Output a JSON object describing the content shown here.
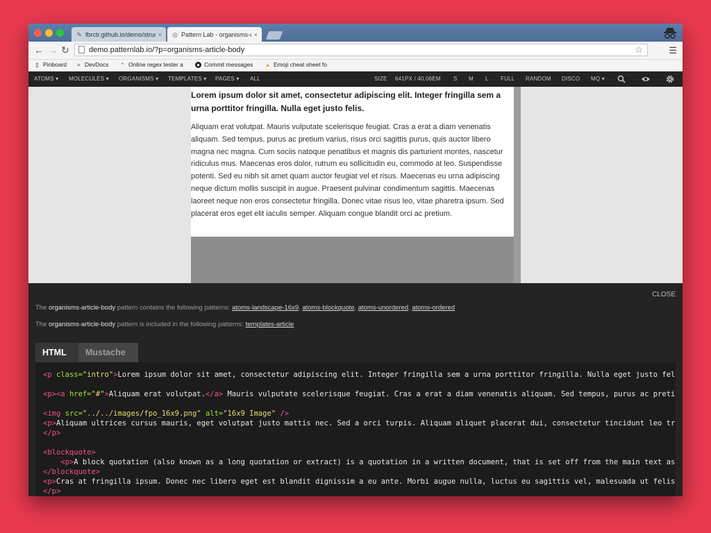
{
  "browser": {
    "tabs": [
      {
        "title": "fbrctr.github.io/demo/struc",
        "close": "×",
        "active": false
      },
      {
        "title": "Pattern Lab - organisms-a",
        "close": "×",
        "active": true
      }
    ],
    "url": "demo.patternlab.io/?p=organisms-article-body",
    "bookmarks": [
      {
        "label": "Pinboard",
        "icon": "page-icon"
      },
      {
        "label": "DevDocs",
        "icon": "search-icon"
      },
      {
        "label": "Online regex tester a",
        "icon": "regex-icon"
      },
      {
        "label": "Commit messages",
        "icon": "github-icon"
      },
      {
        "label": "Emoji cheat sheet fo",
        "icon": "thumbs-up-icon"
      }
    ]
  },
  "toolbar": {
    "nav": [
      "ATOMS ▾",
      "MOLECULES ▾",
      "ORGANISMS ▾",
      "TEMPLATES ▾",
      "PAGES ▾",
      "ALL"
    ],
    "size_label": "SIZE",
    "size_value": "641PX / 40.06EM",
    "sizes": [
      "S",
      "M",
      "L",
      "FULL",
      "RANDOM",
      "DISCO",
      "MQ ▾"
    ]
  },
  "article": {
    "intro": "Lorem ipsum dolor sit amet, consectetur adipiscing elit. Integer fringilla sem a urna porttitor fringilla. Nulla eget justo felis.",
    "paragraph": "Aliquam erat volutpat. Mauris vulputate scelerisque feugiat. Cras a erat a diam venenatis aliquam. Sed tempus, purus ac pretium varius, risus orci sagittis purus, quis auctor libero magna nec magna. Cum sociis natoque penatibus et magnis dis parturient montes, nascetur ridiculus mus. Maecenas eros dolor, rutrum eu sollicitudin eu, commodo at leo. Suspendisse potenti. Sed eu nibh sit amet quam auctor feugiat vel et risus. Maecenas eu urna adipiscing neque dictum mollis suscipit in augue. Praesent pulvinar condimentum sagittis. Maecenas laoreet neque non eros consectetur fringilla. Donec vitae risus leo, vitae pharetra ipsum. Sed placerat eros eget elit iaculis semper. Aliquam congue blandit orci ac pretium."
  },
  "panel": {
    "close": "CLOSE",
    "contains": {
      "prefix": "The",
      "name": "organisms-article-body",
      "text": "pattern contains the following patterns:",
      "links": [
        "atoms-landscape-16x9",
        "atoms-blockquote",
        "atoms-unordered",
        "atoms-ordered"
      ]
    },
    "included": {
      "prefix": "The",
      "name": "organisms-article-body",
      "text": "pattern is included in the following patterns:",
      "links": [
        "templates-article"
      ]
    },
    "tabs": [
      "HTML",
      "Mustache"
    ],
    "code": {
      "l1_text": "Lorem ipsum dolor sit amet, consectetur adipiscing elit. Integer fringilla sem a urna porttitor fringilla. Nulla eget justo felis.",
      "l2_link": "Aliquam erat volutpat.",
      "l2_text": " Mauris vulputate scelerisque feugiat. Cras a erat a diam venenatis aliquam. Sed tempus, purus ac pretium varius,",
      "l3_src": "\"../../images/fpo_16x9.png\"",
      "l3_alt": "\"16x9 Image\"",
      "l4_text": "Aliquam ultrices cursus mauris, eget volutpat justo mattis nec. Sed a orci turpis. Aliquam aliquet placerat dui, consectetur tincidunt leo tristique",
      "l6_text": "A block quotation (also known as a long quotation or extract) is a quotation in a written document, that is set off from the main text as a paragraph",
      "l8_text": "Cras at fringilla ipsum. Donec nec libero eget est blandit dignissim a eu ante. Morbi augue nulla, luctus eu sagittis vel, malesuada ut felis."
    }
  },
  "colors": {
    "background": "#e8394f",
    "panel_bg": "#242424",
    "tag": "#f24f8c",
    "attr": "#a6e22e",
    "string": "#e6db74"
  }
}
